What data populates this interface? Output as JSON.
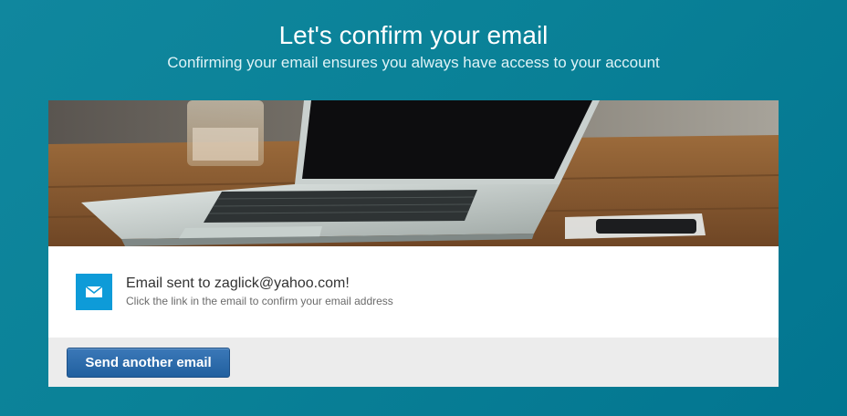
{
  "header": {
    "title": "Let's confirm your email",
    "subtitle": "Confirming your email ensures you always have access to your account"
  },
  "hero": {
    "image_description_icon": "laptop-on-desk-image"
  },
  "message": {
    "icon": "envelope-icon",
    "title": "Email sent to zaglick@yahoo.com!",
    "subtitle": "Click the link in the email to confirm your email address"
  },
  "footer": {
    "send_button_label": "Send another email"
  },
  "colors": {
    "background": "#0a8197",
    "mail_icon_bg": "#0e9bd8",
    "button": "#2a67a7",
    "footer_bg": "#ececec"
  }
}
